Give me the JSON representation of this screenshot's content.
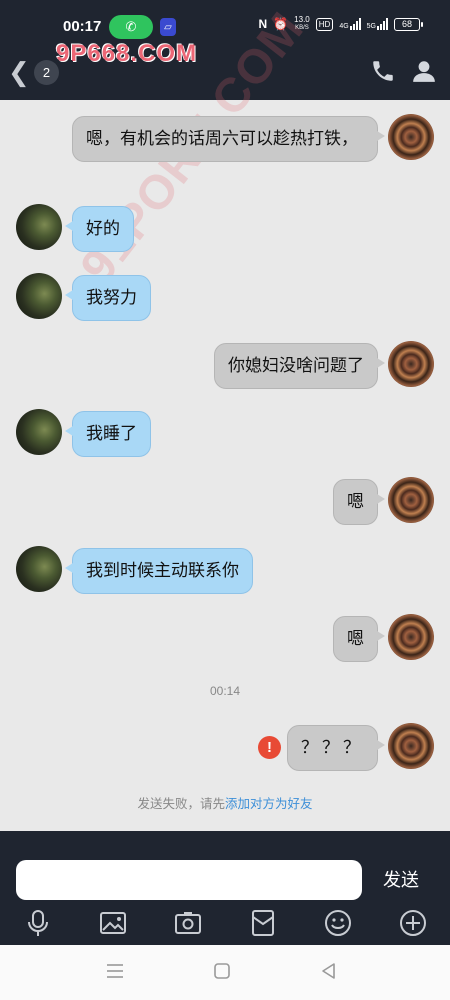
{
  "status_bar": {
    "time": "00:17",
    "nfc": "N",
    "speed_value": "13.0",
    "speed_unit": "KB/S",
    "hd": "HD",
    "net1": "4G",
    "net2": "5G",
    "battery": "68"
  },
  "header": {
    "unread_count": "2"
  },
  "watermarks": {
    "top": "9P668.COM",
    "diagonal": "91PORN.COM"
  },
  "messages": [
    {
      "side": "right",
      "text": "嗯，有机会的话周六可以趁热打铁，"
    },
    {
      "side": "left",
      "text": "好的"
    },
    {
      "side": "left",
      "text": "我努力"
    },
    {
      "side": "right",
      "text": "你媳妇没啥问题了"
    },
    {
      "side": "left",
      "text": "我睡了"
    },
    {
      "side": "right",
      "text": "嗯"
    },
    {
      "side": "left",
      "text": "我到时候主动联系你"
    },
    {
      "side": "right",
      "text": "嗯"
    },
    {
      "side": "right",
      "text": "？？？"
    }
  ],
  "timestamp": "00:14",
  "fail_icon": "!",
  "fail_notice": {
    "prefix": "发送失败，请先",
    "link": "添加对方为好友"
  },
  "composer": {
    "input_value": "",
    "send_label": "发送"
  },
  "icons": {
    "phone": "phone-icon",
    "contact": "contact-icon",
    "mic": "mic-icon",
    "image": "image-icon",
    "camera": "camera-icon",
    "red_packet": "red-packet-icon",
    "emoji": "emoji-icon",
    "plus": "plus-icon"
  },
  "colors": {
    "dark_bar": "#1f2530",
    "incoming_bubble": "#a9d8f6",
    "outgoing_bubble": "#c9c9c9",
    "fail_red": "#e84a35",
    "link_blue": "#3d8fd8"
  }
}
